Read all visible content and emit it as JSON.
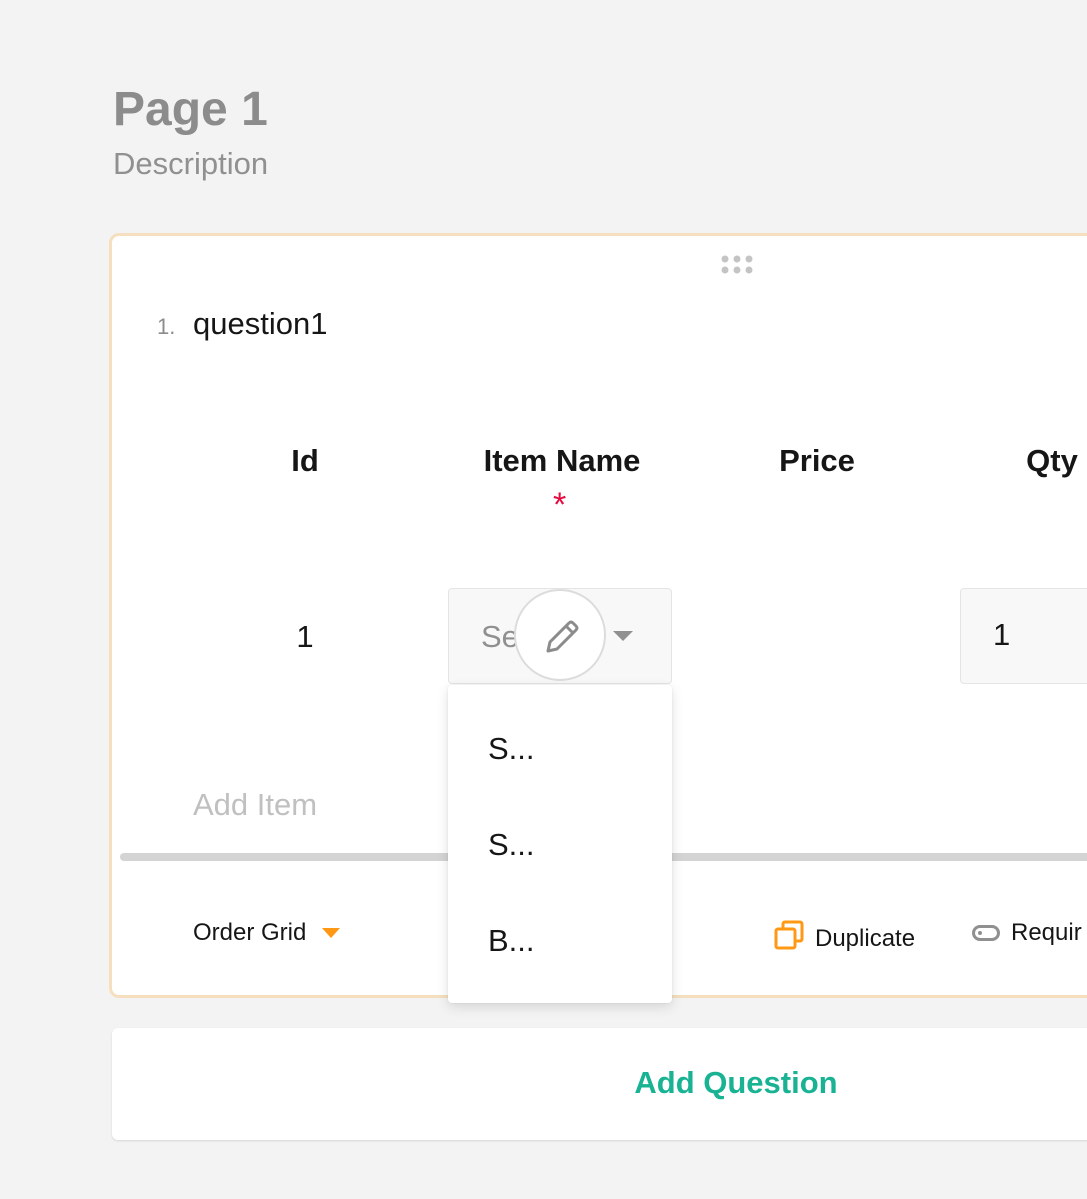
{
  "page": {
    "title": "Page 1",
    "description": "Description"
  },
  "question": {
    "number": "1.",
    "title": "question1",
    "columns": [
      "Id",
      "Item Name",
      "Price",
      "Qty"
    ],
    "required_mark": "*",
    "row": {
      "id": "1",
      "item_select_placeholder": "Se",
      "qty": "1"
    },
    "add_item_label": "Add Item",
    "dropdown_options": [
      "S...",
      "S...",
      "B..."
    ]
  },
  "toolbar": {
    "type_label": "Order Grid",
    "duplicate_label": "Duplicate",
    "required_label": "Requir"
  },
  "add_question_label": "Add Question",
  "colors": {
    "accent": "#19b394",
    "warning": "#ff9814",
    "required": "#e60a3e",
    "card_border": "#f5dfbf"
  }
}
